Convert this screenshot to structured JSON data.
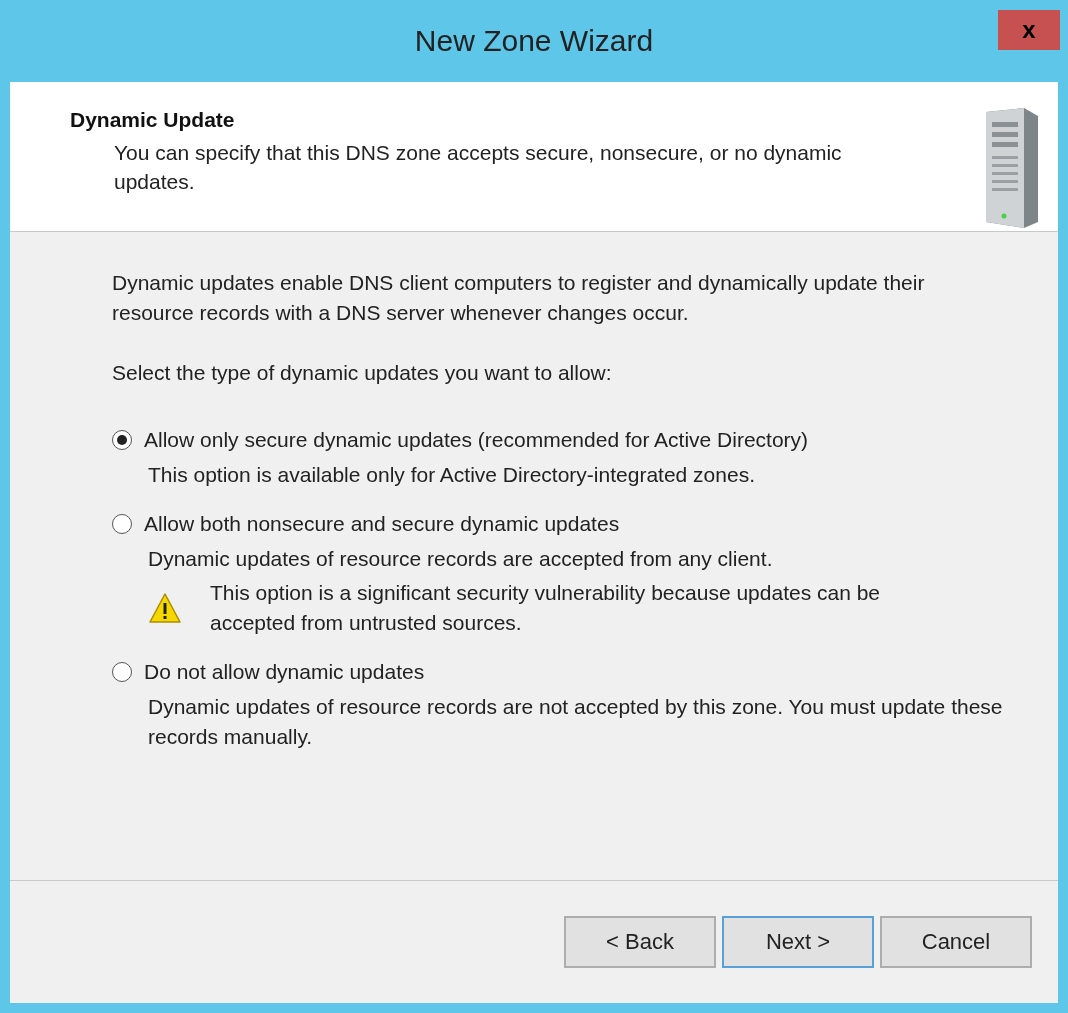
{
  "window": {
    "title": "New Zone Wizard",
    "close": "x"
  },
  "header": {
    "title": "Dynamic Update",
    "subtitle": "You can specify that this DNS zone accepts secure, nonsecure, or no dynamic updates."
  },
  "intro": "Dynamic updates enable DNS client computers to register and dynamically update their resource records with a DNS server whenever changes occur.",
  "prompt": "Select the type of dynamic updates you want to allow:",
  "options": [
    {
      "label": "Allow only secure dynamic updates (recommended for Active Directory)",
      "description": "This option is available only for Active Directory-integrated zones.",
      "selected": true
    },
    {
      "label": "Allow both nonsecure and secure dynamic updates",
      "description": "Dynamic updates of resource records are accepted from any client.",
      "warning": "This option is a significant security vulnerability because updates can be accepted from untrusted sources.",
      "selected": false
    },
    {
      "label": "Do not allow dynamic updates",
      "description": "Dynamic updates of resource records are not accepted by this zone. You must update these records manually.",
      "selected": false
    }
  ],
  "buttons": [
    {
      "label": "< Back",
      "default": false
    },
    {
      "label": "Next >",
      "default": true
    },
    {
      "label": "Cancel",
      "default": false
    }
  ]
}
